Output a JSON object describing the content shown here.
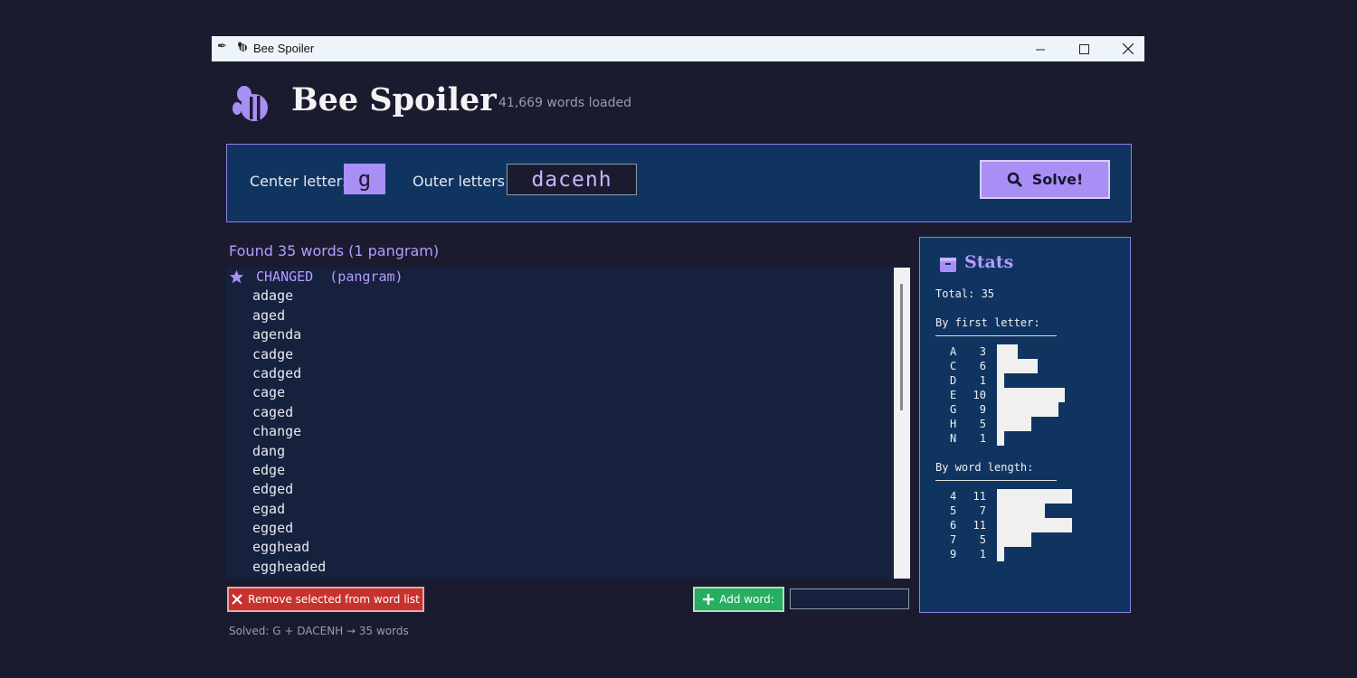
{
  "window": {
    "title": "Bee Spoiler"
  },
  "header": {
    "title": "Bee Spoiler",
    "words_loaded": "41,669 words loaded"
  },
  "inputs": {
    "center_label": "Center letter:",
    "center_value": "g",
    "outer_label": "Outer letters:",
    "outer_value": "dacenh",
    "solve_label": "Solve!"
  },
  "results": {
    "found_text": "Found 35 words  (1 pangram)",
    "words": [
      "CHANGED  (pangram)",
      "adage",
      "aged",
      "agenda",
      "cadge",
      "cadged",
      "cage",
      "caged",
      "change",
      "dang",
      "edge",
      "edged",
      "egad",
      "egged",
      "egghead",
      "eggheaded"
    ]
  },
  "actions": {
    "remove_label": "Remove selected from word list",
    "add_label": "Add word:",
    "add_value": ""
  },
  "status": "Solved: G + DACENH → 35 words",
  "stats": {
    "title": "Stats",
    "total": "Total: 35",
    "by_first_letter_label": "By first letter:",
    "by_first_letter": [
      {
        "key": "A",
        "count": 3
      },
      {
        "key": "C",
        "count": 6
      },
      {
        "key": "D",
        "count": 1
      },
      {
        "key": "E",
        "count": 10
      },
      {
        "key": "G",
        "count": 9
      },
      {
        "key": "H",
        "count": 5
      },
      {
        "key": "N",
        "count": 1
      }
    ],
    "by_length_label": "By word length:",
    "by_length": [
      {
        "key": "4",
        "count": 11
      },
      {
        "key": "5",
        "count": 7
      },
      {
        "key": "6",
        "count": 11
      },
      {
        "key": "7",
        "count": 5
      },
      {
        "key": "9",
        "count": 1
      }
    ]
  },
  "colors": {
    "accent": "#a98ef5",
    "panel": "#0f3460",
    "list_bg": "#16213e",
    "bg": "#1b1b30",
    "remove": "#c8322d",
    "add": "#27ae60"
  },
  "icons": [
    "feather-icon",
    "bee-icon",
    "magnifier-icon",
    "star-icon",
    "close-x-icon",
    "plus-icon",
    "box-icon"
  ]
}
